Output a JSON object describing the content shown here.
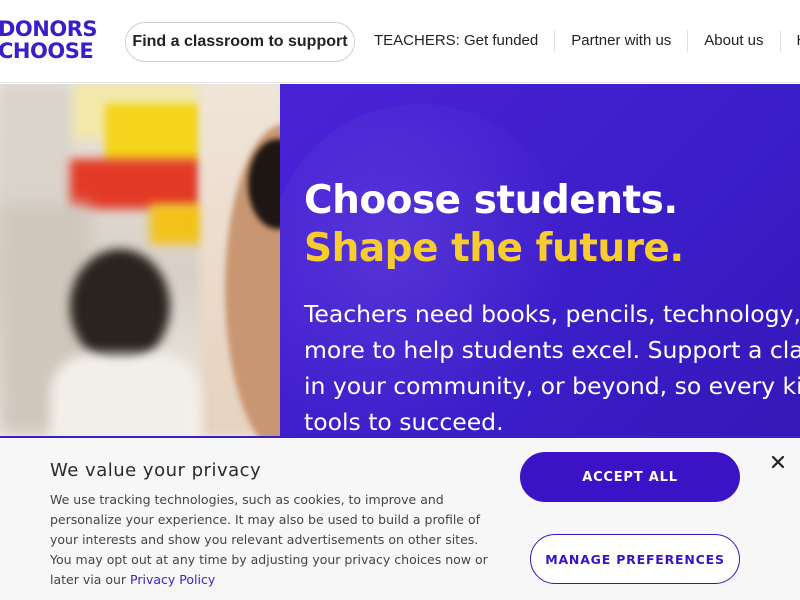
{
  "header": {
    "logo": {
      "line1": "DONORS",
      "line2": "CHOOSE"
    },
    "find_button": "Find a classroom to support",
    "nav": [
      {
        "label": "TEACHERS: Get funded"
      },
      {
        "label": "Partner with us"
      },
      {
        "label": "About us"
      },
      {
        "label": "Help"
      }
    ]
  },
  "hero": {
    "headline": "Choose students.",
    "subheadline": "Shape the future.",
    "body_lines": [
      "Teachers need books, pencils, technology,",
      "more to help students excel. Support a cla",
      "in your community, or beyond, so every kid",
      "tools to succeed."
    ]
  },
  "privacy": {
    "title": "We value your privacy",
    "text_lines": [
      "We use tracking technologies, such as cookies, to improve and",
      "personalize your experience. It may also be used to build a profile of",
      "your interests and show you relevant advertisements on other sites.",
      "You may opt out at any time by adjusting your privacy choices now or"
    ],
    "last_line_prefix": "later via our ",
    "policy_link": "Privacy Policy",
    "accept_button": "ACCEPT ALL",
    "manage_button": "MANAGE PREFERENCES",
    "close_icon": "close-icon"
  },
  "colors": {
    "brand_purple": "#3b1ec8",
    "headline_yellow": "#f6cc2e",
    "white": "#ffffff"
  }
}
